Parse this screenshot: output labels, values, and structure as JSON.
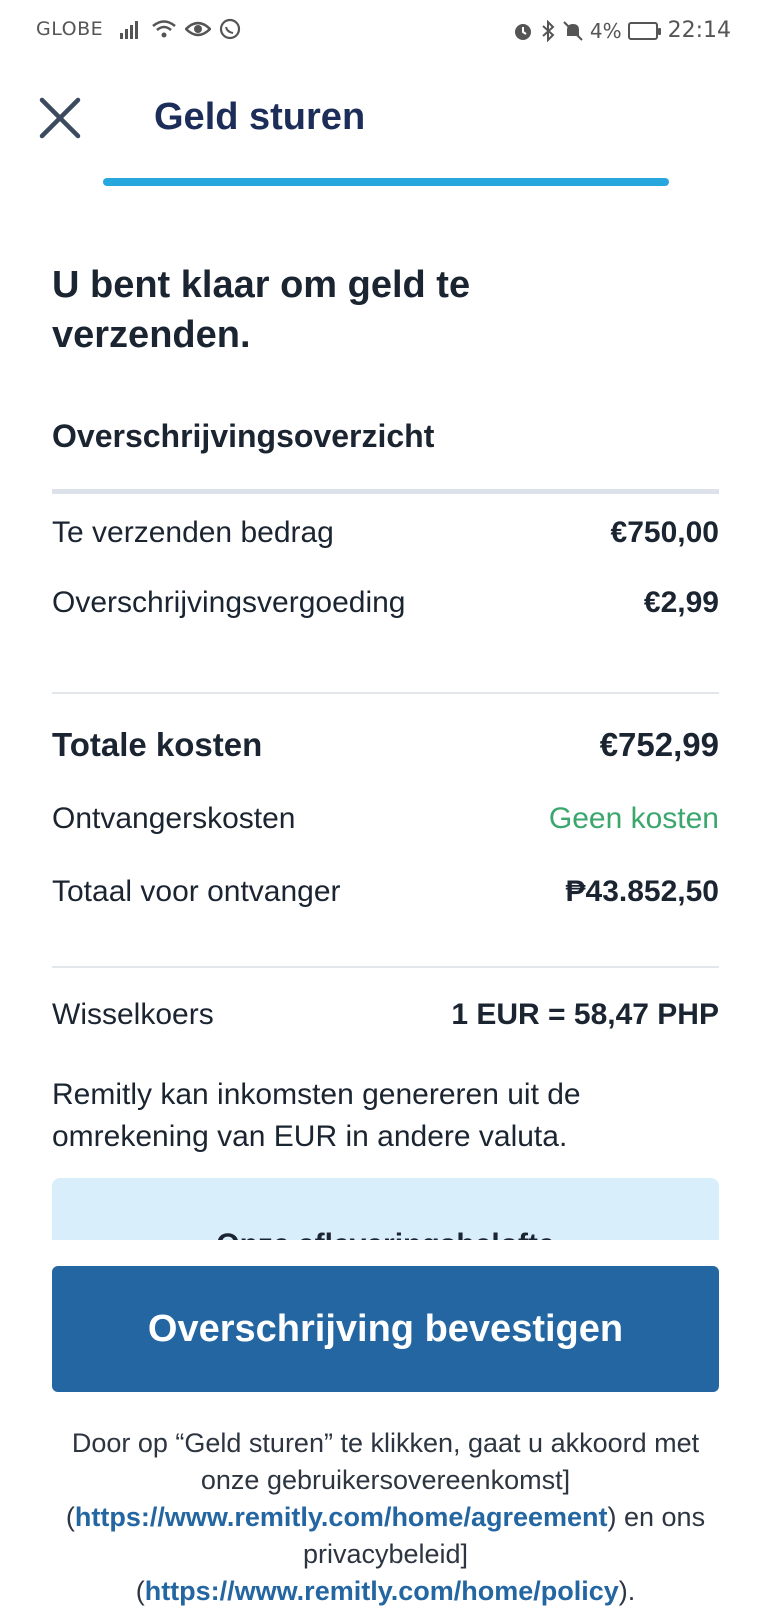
{
  "status_bar": {
    "carrier": "GLOBE",
    "battery_percent": "4%",
    "time": "22:14",
    "icons": [
      "signal-icon",
      "wifi-icon",
      "eye-icon",
      "whatsapp-icon",
      "alarm-icon",
      "bluetooth-icon",
      "mute-icon",
      "battery-icon"
    ]
  },
  "header": {
    "title": "Geld sturen",
    "close_icon": "close-icon",
    "progress_fraction": 1.0,
    "accent_color": "#26a8de"
  },
  "main": {
    "heading": "U bent klaar om geld te verzenden.",
    "summary_title": "Overschrijvingsoverzicht",
    "rows": {
      "amount_label": "Te verzenden bedrag",
      "amount_value": "€750,00",
      "fee_label": "Overschrijvingsvergoeding",
      "fee_value": "€2,99",
      "total_label": "Totale kosten",
      "total_value": "€752,99",
      "recipient_fee_label": "Ontvangerskosten",
      "recipient_fee_value": "Geen kosten",
      "recipient_total_label": "Totaal voor ontvanger",
      "recipient_total_value": "₱43.852,50",
      "rate_label": "Wisselkoers",
      "rate_value": "1 EUR = 58,47 PHP"
    },
    "disclaimer": "Remitly kan inkomsten genereren uit de omrekening van EUR in andere valuta.",
    "promise_title": "Onze afleveringsbelofte"
  },
  "confirm_button": {
    "label": "Overschrijving bevestigen",
    "color": "#2466a1"
  },
  "footer": {
    "text_1": "Door op “Geld sturen” te klikken, gaat u akkoord met onze gebruikersovereenkomst] (",
    "link_1": "https://www.remitly.com/home/agreement",
    "text_2": ") en ons privacybeleid] (",
    "link_2": "https://www.remitly.com/home/policy",
    "text_3": ")."
  },
  "colors": {
    "title": "#1c2d5a",
    "text": "#1b2431",
    "success": "#3aa76d",
    "promise_bg": "#d9eefb"
  }
}
